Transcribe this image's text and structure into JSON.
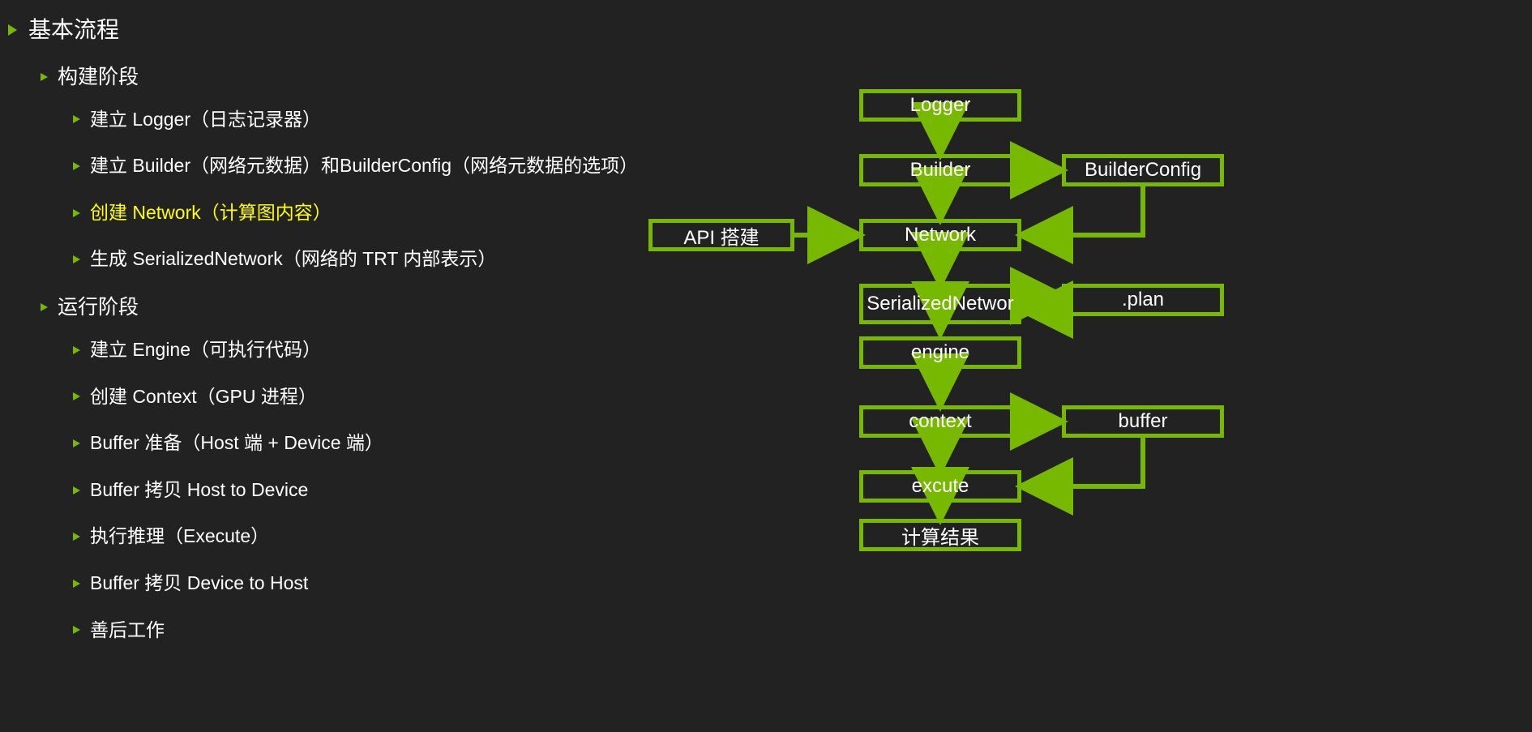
{
  "outline": {
    "title": "基本流程",
    "sections": [
      {
        "heading": "构建阶段",
        "items": [
          {
            "text": "建立 Logger（日志记录器）",
            "highlight": false
          },
          {
            "text": "建立 Builder（网络元数据）和BuilderConfig（网络元数据的选项）",
            "highlight": false
          },
          {
            "text": "创建 Network（计算图内容）",
            "highlight": true
          },
          {
            "text": "生成 SerializedNetwork（网络的 TRT 内部表示）",
            "highlight": false
          }
        ]
      },
      {
        "heading": "运行阶段",
        "items": [
          {
            "text": "建立 Engine（可执行代码）",
            "highlight": false
          },
          {
            "text": "创建 Context（GPU 进程）",
            "highlight": false
          },
          {
            "text": "Buffer 准备（Host 端 + Device 端）",
            "highlight": false
          },
          {
            "text": "Buffer 拷贝 Host to Device",
            "highlight": false
          },
          {
            "text": "执行推理（Execute）",
            "highlight": false
          },
          {
            "text": "Buffer 拷贝 Device to Host",
            "highlight": false
          },
          {
            "text": "善后工作",
            "highlight": false
          }
        ]
      }
    ]
  },
  "diagram": {
    "nodes": {
      "logger": "Logger",
      "builder": "Builder",
      "builderConfig": "BuilderConfig",
      "api": "API 搭建",
      "network": "Network",
      "serialized": "SerializedNetwor",
      "plan": ".plan",
      "engine": "engine",
      "context": "context",
      "buffer": "buffer",
      "execute": "excute",
      "result": "计算结果"
    }
  },
  "colors": {
    "accent": "#76b900",
    "bg": "#222222",
    "highlight": "#ffff00"
  }
}
